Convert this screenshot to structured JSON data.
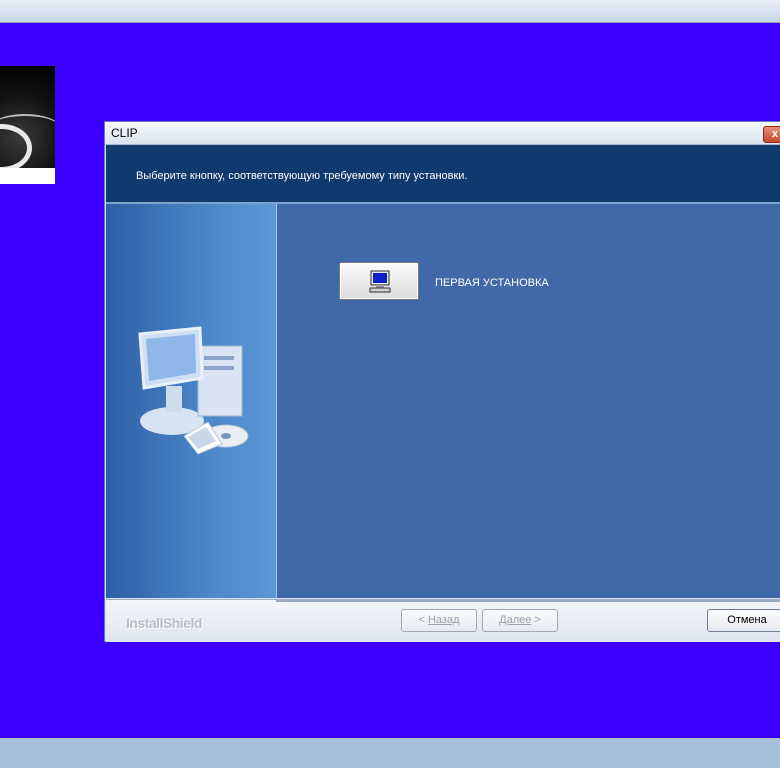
{
  "window": {
    "title": "CLIP",
    "close_label": "x",
    "banner_text": "Выберите кнопку, соответствующую требуемому типу установки."
  },
  "main": {
    "install_option_label": "ПЕРВАЯ УСТАНОВКА"
  },
  "footer": {
    "brand": "InstallShield",
    "back_arrow": "<",
    "back_label": "Назад",
    "next_label": "Далее",
    "next_arrow": ">",
    "cancel_label": "Отмена"
  },
  "icons": {
    "install_button_icon": "monitor-icon",
    "left_illustration": "computer-illustration-icon"
  },
  "colors": {
    "desktop_background": "#3b00ff",
    "banner": "#0e3a6e",
    "main_panel": "#3f69a8"
  }
}
